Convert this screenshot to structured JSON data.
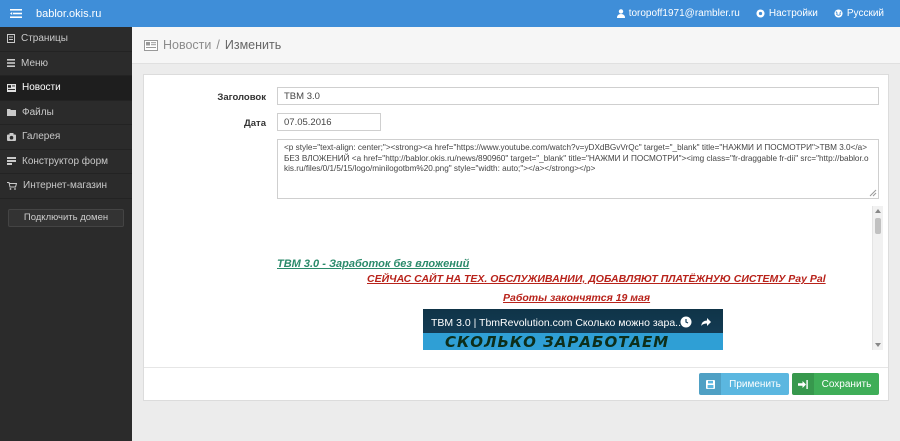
{
  "topbar": {
    "site": "bablor.okis.ru",
    "user": "toropoff1971@rambler.ru",
    "settings": "Настройки",
    "language": "Русский"
  },
  "sidebar": {
    "items": [
      {
        "label": "Страницы",
        "icon": "pages-icon"
      },
      {
        "label": "Меню",
        "icon": "menu-list-icon"
      },
      {
        "label": "Новости",
        "icon": "news-icon",
        "active": true
      },
      {
        "label": "Файлы",
        "icon": "files-icon"
      },
      {
        "label": "Галерея",
        "icon": "camera-icon"
      },
      {
        "label": "Конструктор форм",
        "icon": "form-builder-icon"
      },
      {
        "label": "Интернет-магазин",
        "icon": "cart-icon"
      }
    ],
    "connect_domain": "Подключить домен"
  },
  "breadcrumb": {
    "section": "Новости",
    "separator": "/",
    "current": "Изменить"
  },
  "form": {
    "title_label": "Заголовок",
    "title_value": "TBM 3.0",
    "date_label": "Дата",
    "date_value": "07.05.2016",
    "html_source": "<p style=\"text-align: center;\"><strong><a href=\"https://www.youtube.com/watch?v=yDXdBGvVrQc\" target=\"_blank\" title=\"НАЖМИ И ПОСМОТРИ\">TBM 3.0</a> БЕЗ ВЛОЖЕНИЙ <a href=\"http://bablor.okis.ru/news/890960\" target=\"_blank\" title=\"НАЖМИ И ПОСМОТРИ\"><img class=\"fr-draggable fr-dii\" src=\"http://bablor.okis.ru/files/0/1/5/15/logo/minilogotbm%20.png\" style=\"width: auto;\"></a></strong></p>"
  },
  "preview": {
    "line1": "TBM 3.0  -  Заработок без вложений",
    "line2": "СЕЙЧАС САЙТ НА ТЕХ. ОБСЛУЖИВАНИИ, ДОБАВЛЯЮТ ПЛАТЁЖНУЮ СИСТЕМУ Pay Pal",
    "line3": "Работы закончятся 19 мая",
    "video_title": "TBM 3.0 | TbmRevolution.com Сколько можно зара...",
    "video_banner": "СКОЛЬКО ЗАРАБОТАЕМ"
  },
  "actions": {
    "apply": "Применить",
    "save": "Сохранить"
  },
  "colors": {
    "topbar": "#3f8ed8",
    "sidebar": "#2b2b2b",
    "apply": "#5bb7e0",
    "save": "#3fae58"
  }
}
